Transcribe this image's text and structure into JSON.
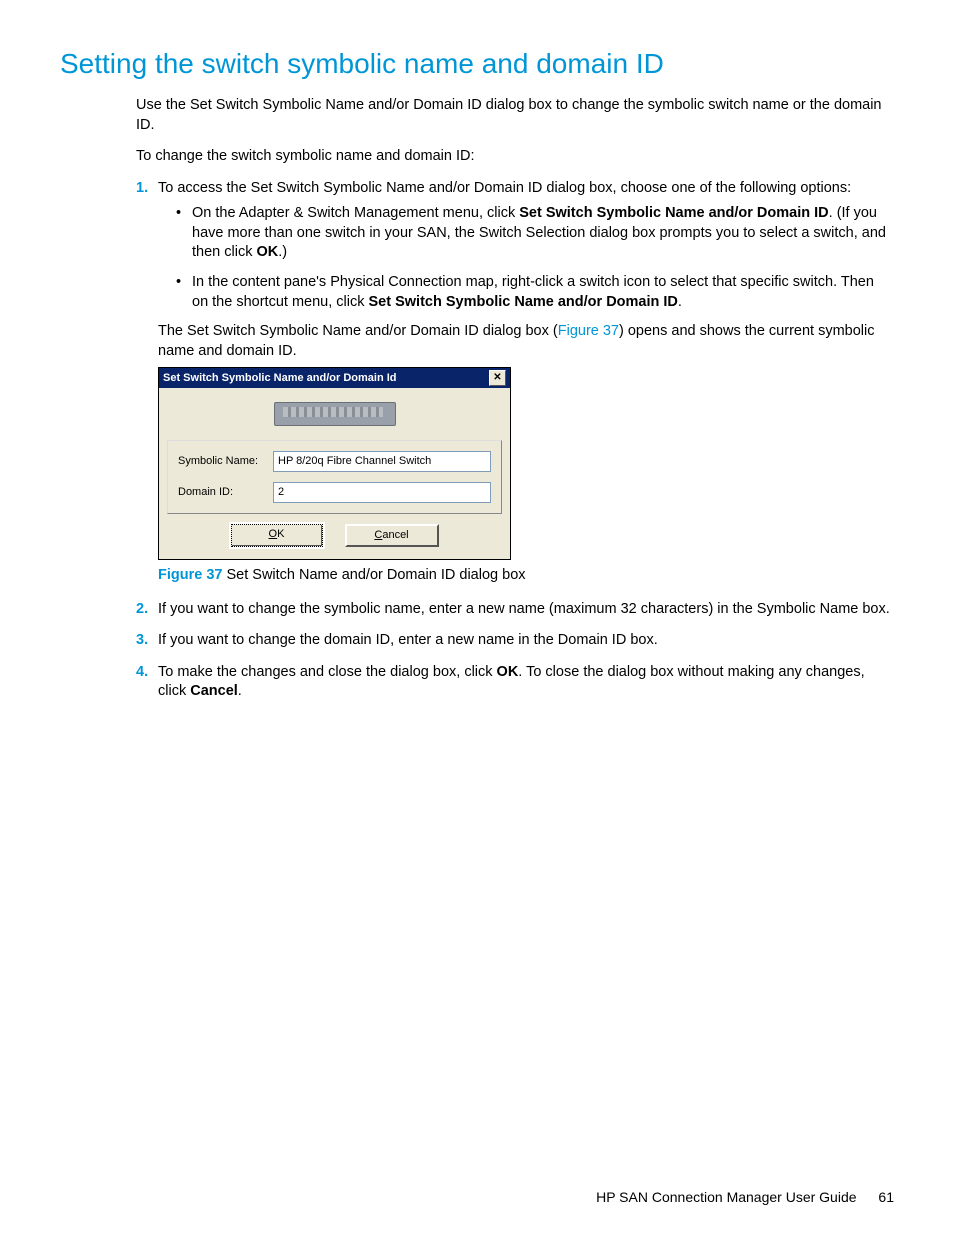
{
  "heading": "Setting the switch symbolic name and domain ID",
  "intro": "Use the Set Switch Symbolic Name and/or Domain ID dialog box to change the symbolic switch name or the domain ID.",
  "intro2": "To change the switch symbolic name and domain ID:",
  "steps": {
    "s1_lead": "To access the Set Switch Symbolic Name and/or Domain ID dialog box, choose one of the following options:",
    "s1_b1_a": "On the Adapter & Switch Management menu, click ",
    "s1_b1_bold": "Set Switch Symbolic Name and/or Domain ID",
    "s1_b1_b": ". (If you have more than one switch in your SAN, the Switch Selection dialog box prompts you to select a switch, and then click ",
    "s1_b1_ok": "OK",
    "s1_b1_c": ".)",
    "s1_b2_a": "In the content pane's Physical Connection map, right-click a switch icon to select that specific switch. Then on the shortcut menu, click ",
    "s1_b2_bold": "Set Switch Symbolic Name and/or Domain ID",
    "s1_b2_b": ".",
    "s1_after_a": "The Set Switch Symbolic Name and/or Domain ID dialog box (",
    "s1_after_link": "Figure 37",
    "s1_after_b": ") opens and shows the current symbolic name and domain ID.",
    "s2": "If you want to change the symbolic name, enter a new name (maximum 32 characters) in the Symbolic Name box.",
    "s3": "If you want to change the domain ID, enter a new name in the Domain ID box.",
    "s4_a": "To make the changes and close the dialog box, click ",
    "s4_ok": "OK",
    "s4_b": ". To close the dialog box without making any changes, click ",
    "s4_cancel": "Cancel",
    "s4_c": "."
  },
  "dialog": {
    "title": "Set Switch Symbolic Name and/or Domain Id",
    "symbolic_label": "Symbolic Name:",
    "symbolic_value": "HP 8/20q Fibre Channel Switch",
    "domain_label": "Domain ID:",
    "domain_value": "2",
    "ok_prefix": "O",
    "ok_rest": "K",
    "cancel_prefix": "C",
    "cancel_rest": "ancel"
  },
  "figure": {
    "label": "Figure 37",
    "caption": " Set Switch Name and/or Domain ID dialog box"
  },
  "footer": {
    "doc": "HP SAN Connection Manager User Guide",
    "page": "61"
  },
  "nums": {
    "n1": "1.",
    "n2": "2.",
    "n3": "3.",
    "n4": "4."
  }
}
